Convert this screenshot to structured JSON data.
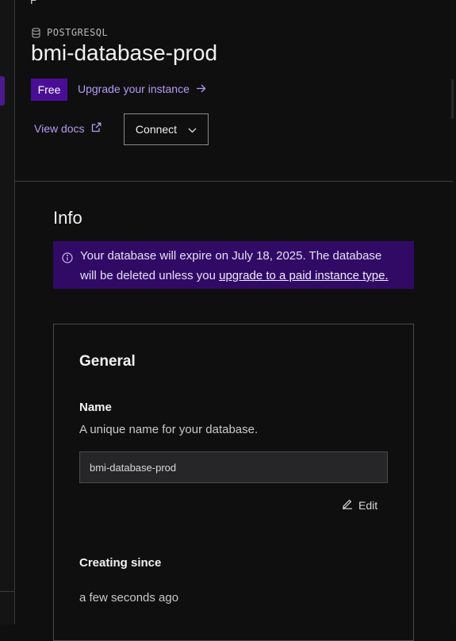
{
  "top_partial_text": "P",
  "header": {
    "engine_label": "POSTGRESQL",
    "engine_icon": "database-icon",
    "database_name": "bmi-database-prod",
    "plan_badge": "Free",
    "upgrade_link": "Upgrade your instance",
    "docs_link": "View docs",
    "connect_button": "Connect"
  },
  "info": {
    "title": "Info",
    "notice": {
      "line1": "Your database will expire on July 18, 2025. The database",
      "line2_prefix": "will be deleted unless you ",
      "line2_link": "upgrade to a paid instance type."
    }
  },
  "general": {
    "title": "General",
    "name_label": "Name",
    "name_help": "A unique name for your database.",
    "name_value": "bmi-database-prod",
    "edit_button": "Edit",
    "creating_label": "Creating since",
    "creating_value": "a few seconds ago"
  },
  "colors": {
    "accent": "#4a0e96",
    "link": "#b69cf5",
    "notice_bg": "#310a66",
    "background": "#0f0f10"
  }
}
